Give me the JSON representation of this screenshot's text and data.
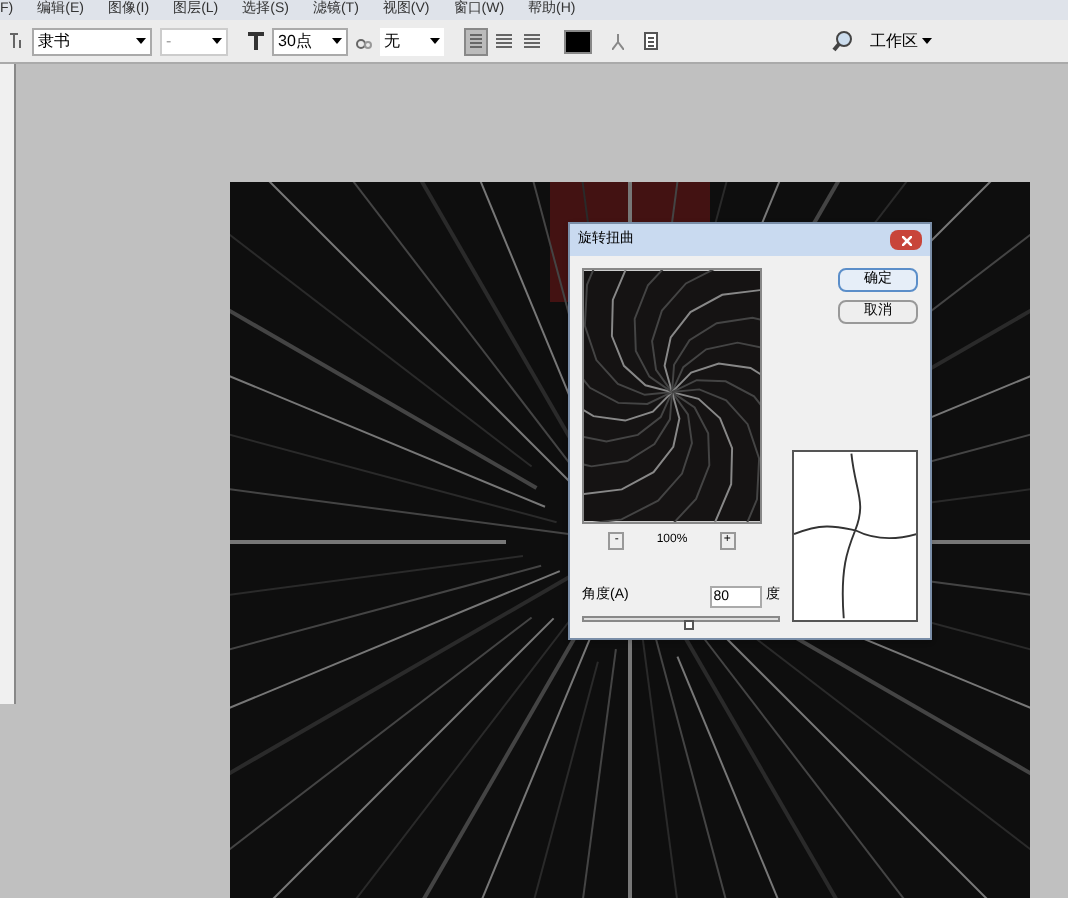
{
  "menu_bar": {
    "items": [
      "F)",
      "编辑(E)",
      "图像(I)",
      "图层(L)",
      "选择(S)",
      "滤镜(T)",
      "视图(V)",
      "窗口(W)",
      "帮助(H)"
    ]
  },
  "options_bar": {
    "font_family": "隶书",
    "font_style": "-",
    "font_size": "30点",
    "antialias": "无",
    "alignment": [
      {
        "selected": true
      },
      {
        "selected": false
      },
      {
        "selected": false
      }
    ],
    "workspace_button": "工作区"
  },
  "dialog": {
    "title": "旋转扭曲",
    "ok_button": "确定",
    "cancel_button": "取消",
    "zoom_out": "-",
    "zoom_level": "100%",
    "zoom_in": "+",
    "angle_label": "角度(A)",
    "angle_value": "80",
    "angle_unit": "度",
    "angle_slider": {
      "level": 0.54
    }
  }
}
